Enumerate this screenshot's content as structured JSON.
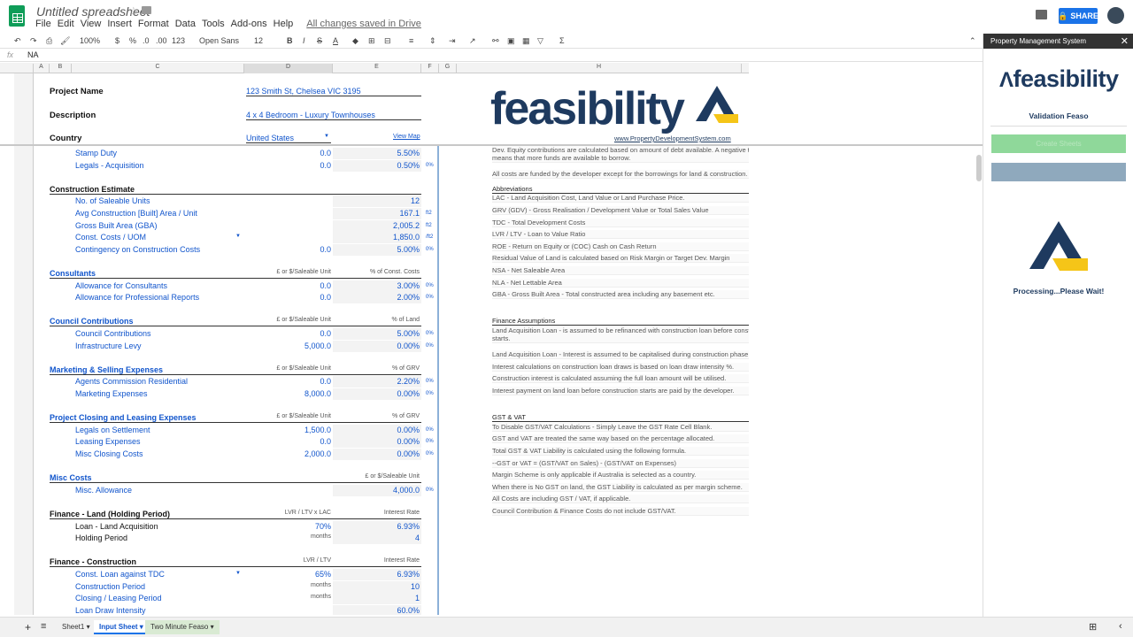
{
  "app": {
    "doc_title": "Untitled spreadsheet",
    "menus": [
      "File",
      "Edit",
      "View",
      "Insert",
      "Format",
      "Data",
      "Tools",
      "Add-ons",
      "Help"
    ],
    "saved": "All changes saved in Drive",
    "share": "SHARE"
  },
  "toolbar": {
    "zoom": "100%",
    "currency": "$",
    "percent": "%",
    "dec_less": ".0",
    "dec_more": ".00",
    "format": "123",
    "font": "Open Sans",
    "size": "12"
  },
  "formula": {
    "fx": "fx",
    "value": "NA"
  },
  "columns": [
    "A",
    "B",
    "C",
    "D",
    "E",
    "F",
    "G",
    "H"
  ],
  "header": {
    "project_name_label": "Project Name",
    "project_name": "123 Smith St, Chelsea VIC 3195",
    "description_label": "Description",
    "description": "4 x 4 Bedroom - Luxury Townhouses",
    "country_label": "Country",
    "country": "United States",
    "view_map": "View Map",
    "logo": "feasibility",
    "website": "www.PropertyDevelopmentSystem.com"
  },
  "rows": [
    {
      "n": "20",
      "c": "Stamp Duty",
      "d": "0.0",
      "e": "5.50%"
    },
    {
      "n": "21",
      "c": "Legals - Acquisition",
      "d": "0.0",
      "e": "0.50%",
      "f": "0%"
    },
    {
      "n": "22"
    },
    {
      "n": "23",
      "sec": "Construction Estimate",
      "style": "black"
    },
    {
      "n": "24",
      "c": "No. of Saleable Units",
      "e": "12"
    },
    {
      "n": "25",
      "c": "Avg Construction [Built] Area / Unit",
      "e": "167.1",
      "f": "ft2"
    },
    {
      "n": "26",
      "c": "Gross Built Area (GBA)",
      "e": "2,005.2",
      "f": "ft2"
    },
    {
      "n": "27",
      "c": "Const. Costs / UOM",
      "e": "1,850.0",
      "f": "/ft2"
    },
    {
      "n": "28",
      "c": "Contingency on Construction Costs",
      "d": "0.0",
      "e": "5.00%",
      "f": "0%"
    },
    {
      "n": "29"
    },
    {
      "n": "30",
      "sec": "Consultants",
      "style": "blue",
      "dh": "£ or $/Saleable Unit",
      "eh": "% of Const. Costs"
    },
    {
      "n": "31",
      "c": "Allowance for Consultants",
      "d": "0.0",
      "e": "3.00%",
      "f": "0%"
    },
    {
      "n": "32",
      "c": "Allowance for Professional Reports",
      "d": "0.0",
      "e": "2.00%",
      "f": "0%"
    },
    {
      "n": "33"
    },
    {
      "n": "34",
      "sec": "Council Contributions",
      "style": "blue",
      "dh": "£ or $/Saleable Unit",
      "eh": "% of Land"
    },
    {
      "n": "35",
      "c": "Council Contributions",
      "d": "0.0",
      "e": "5.00%",
      "f": "0%"
    },
    {
      "n": "36",
      "c": "Infrastructure Levy",
      "d": "5,000.0",
      "e": "0.00%",
      "f": "0%"
    },
    {
      "n": "37"
    },
    {
      "n": "38",
      "sec": "Marketing & Selling Expenses",
      "style": "blue",
      "dh": "£ or $/Saleable Unit",
      "eh": "% of GRV"
    },
    {
      "n": "39",
      "c": "Agents Commission Residential",
      "d": "0.0",
      "e": "2.20%",
      "f": "0%"
    },
    {
      "n": "40",
      "c": "Marketing Expenses",
      "d": "8,000.0",
      "e": "0.00%",
      "f": "0%"
    },
    {
      "n": "41"
    },
    {
      "n": "42",
      "sec": "Project Closing and Leasing Expenses",
      "style": "blue",
      "dh": "£ or $/Saleable Unit",
      "eh": "% of GRV"
    },
    {
      "n": "43",
      "c": "Legals on Settlement",
      "d": "1,500.0",
      "e": "0.00%",
      "f": "0%"
    },
    {
      "n": "44",
      "c": "Leasing Expenses",
      "d": "0.0",
      "e": "0.00%",
      "f": "0%"
    },
    {
      "n": "45",
      "c": "Misc Closing Costs",
      "d": "2,000.0",
      "e": "0.00%",
      "f": "0%"
    },
    {
      "n": "46"
    },
    {
      "n": "47",
      "sec": "Misc Costs",
      "style": "blue",
      "eh": "£ or $/Saleable Unit"
    },
    {
      "n": "48",
      "c": "Misc. Allowance",
      "e": "4,000.0",
      "f": "0%"
    },
    {
      "n": "49"
    },
    {
      "n": "50",
      "sec": "Finance - Land (Holding Period)",
      "style": "black",
      "dh": "LVR / LTV x LAC",
      "eh": "Interest Rate"
    },
    {
      "n": "51",
      "c": "Loan - Land Acquisition",
      "d": "70%",
      "e": "6.93%",
      "black": true
    },
    {
      "n": "52",
      "c": "Holding Period",
      "dsm": "months",
      "e": "4",
      "black": true
    },
    {
      "n": "53"
    },
    {
      "n": "54",
      "sec": "Finance - Construction",
      "style": "black",
      "dh": "LVR / LTV",
      "eh": "Interest Rate"
    },
    {
      "n": "55",
      "c": "Const. Loan against TDC",
      "d": "65%",
      "e": "6.93%"
    },
    {
      "n": "56",
      "c": "Construction Period",
      "dsm": "months",
      "e": "10"
    },
    {
      "n": "57",
      "c": "Closing / Leasing Period",
      "dsm": "months",
      "e": "1"
    },
    {
      "n": "58",
      "c": "Loan Draw Intensity",
      "e": "60.0%"
    }
  ],
  "notes": [
    {
      "row": 0,
      "text": "Dev. Equity contributions are calculated based on amount of debt available. A negative total means that more funds are available to borrow."
    },
    {
      "row": 2,
      "text": "All costs are funded by the developer except for the borrowings for land & construction."
    },
    {
      "row": 3,
      "text": "Abbreviations",
      "head": true
    },
    {
      "row": 4,
      "text": "LAC - Land Acquisition Cost, Land Value or Land Purchase Price."
    },
    {
      "row": 5,
      "text": "GRV (GDV) - Gross Realisation / Development Value or Total Sales Value"
    },
    {
      "row": 6,
      "text": "TDC - Total Development Costs"
    },
    {
      "row": 7,
      "text": "LVR / LTV - Loan to Value Ratio"
    },
    {
      "row": 8,
      "text": "ROE - Return on Equity or (COC) Cash on Cash Return"
    },
    {
      "row": 9,
      "text": "Residual Value of Land is calculated based on Risk Margin or Target Dev. Margin"
    },
    {
      "row": 10,
      "text": "NSA - Net Saleable Area"
    },
    {
      "row": 11,
      "text": "NLA - Net Lettable Area"
    },
    {
      "row": 12,
      "text": "GBA - Gross Built Area - Total constructed area including any basement etc."
    },
    {
      "row": 14,
      "text": "Finance Assumptions",
      "head": true
    },
    {
      "row": 15,
      "text": "Land Acquisition Loan - is assumed to be refinanced with construction loan before construction starts."
    },
    {
      "row": 17,
      "text": "Land Acquisition Loan - Interest is assumed to be capitalised during construction phase."
    },
    {
      "row": 18,
      "text": "Interest calculations on construction loan draws is based on loan draw intensity %."
    },
    {
      "row": 19,
      "text": "Construction interest is calculated assuming the full loan amount will be utilised."
    },
    {
      "row": 20,
      "text": "Interest payment on land loan before construction starts are paid by the developer."
    },
    {
      "row": 22,
      "text": "GST & VAT",
      "head": true
    },
    {
      "row": 23,
      "text": "To Disable GST/VAT Calculations - Simply Leave the GST Rate Cell Blank."
    },
    {
      "row": 24,
      "text": "GST and VAT are treated the same way based on the percentage allocated."
    },
    {
      "row": 25,
      "text": "Total GST & VAT Liability is calculated using the following formula."
    },
    {
      "row": 26,
      "text": "--GST or VAT = (GST/VAT on Sales) - (GST/VAT on Expenses)"
    },
    {
      "row": 27,
      "text": "Margin Scheme is only applicable if Australia is selected as a country."
    },
    {
      "row": 28,
      "text": "When there is No GST on land, the GST Liability is calculated as per margin scheme."
    },
    {
      "row": 29,
      "text": "All Costs are including GST / VAT, if applicable."
    },
    {
      "row": 30,
      "text": "Council Contribution & Finance Costs do not include GST/VAT."
    }
  ],
  "sidebar": {
    "title": "Property Management System",
    "logo": "feasibility",
    "validation": "Validation Feaso",
    "create": "Create Sheets",
    "processing": "Processing...Please Wait!"
  },
  "tabs": [
    "Sheet1",
    "Input Sheet",
    "Two Minute Feaso"
  ],
  "colors": {
    "brand_navy": "#1e3a5f",
    "brand_yellow": "#f5c518",
    "link_blue": "#1155cc",
    "share_blue": "#1a73e8"
  }
}
